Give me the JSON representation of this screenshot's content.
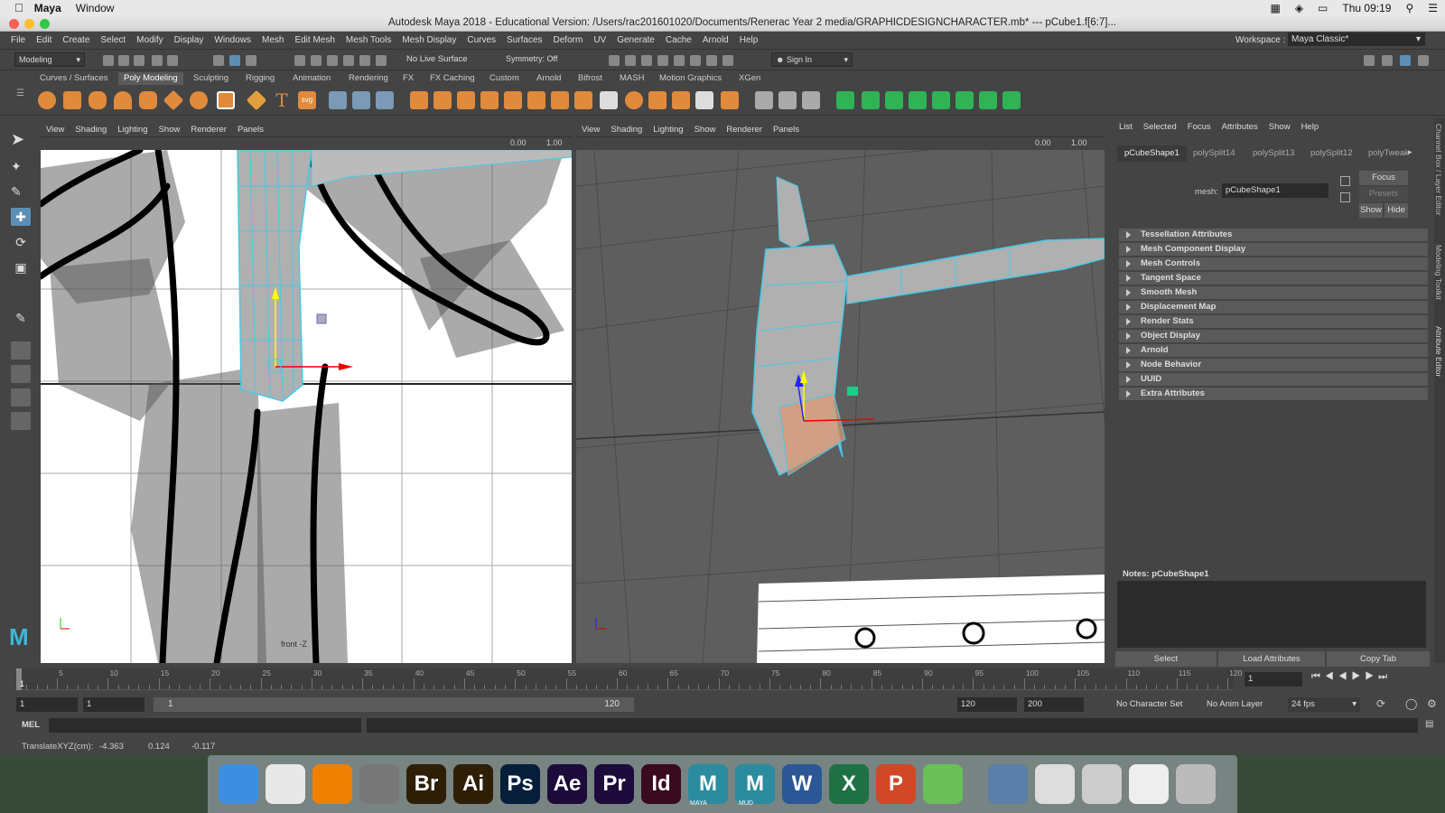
{
  "macmenu": {
    "app": "Maya",
    "items": [
      "Window"
    ],
    "clock": "Thu 09:19"
  },
  "title": "Autodesk Maya 2018 - Educational Version: /Users/rac201601020/Documents/Renerac Year 2 media/GRAPHICDESIGNCHARACTER.mb*   ---   pCube1.f[6:7]...",
  "menus": [
    "File",
    "Edit",
    "Create",
    "Select",
    "Modify",
    "Display",
    "Windows",
    "Mesh",
    "Edit Mesh",
    "Mesh Tools",
    "Mesh Display",
    "Curves",
    "Surfaces",
    "Deform",
    "UV",
    "Generate",
    "Cache",
    "Arnold",
    "Help"
  ],
  "workspace": {
    "label": "Workspace :",
    "value": "Maya Classic*"
  },
  "statusline": {
    "mode": "Modeling",
    "live_surface": "No Live Surface",
    "symmetry": "Symmetry: Off",
    "sign_in": "Sign In"
  },
  "shelf_tabs": [
    "Curves / Surfaces",
    "Poly Modeling",
    "Sculpting",
    "Rigging",
    "Animation",
    "Rendering",
    "FX",
    "FX Caching",
    "Custom",
    "Arnold",
    "Bifrost",
    "MASH",
    "Motion Graphics",
    "XGen"
  ],
  "shelf_active": "Poly Modeling",
  "viewport_menu": [
    "View",
    "Shading",
    "Lighting",
    "Show",
    "Renderer",
    "Panels"
  ],
  "viewport_values": {
    "v1": "0.00",
    "v2": "1.00"
  },
  "viewport1_label": "front -Z",
  "attr_menu": [
    "List",
    "Selected",
    "Focus",
    "Attributes",
    "Show",
    "Help"
  ],
  "attr_tabs": [
    "pCubeShape1",
    "polySplit14",
    "polySplit13",
    "polySplit12",
    "polyTweak"
  ],
  "mesh_label": "mesh:",
  "mesh_value": "pCubeShape1",
  "focus_btn": "Focus",
  "presets_btn": "Presets",
  "show_btn": "Show",
  "hide_btn": "Hide",
  "sections": [
    "Tessellation Attributes",
    "Mesh Component Display",
    "Mesh Controls",
    "Tangent Space",
    "Smooth Mesh",
    "Displacement Map",
    "Render Stats",
    "Object Display",
    "Arnold",
    "Node Behavior",
    "UUID",
    "Extra Attributes"
  ],
  "notes": "Notes:  pCubeShape1",
  "bottom_buttons": [
    "Select",
    "Load Attributes",
    "Copy Tab"
  ],
  "side_tabs": [
    "Channel Box / Layer Editor",
    "Modeling Toolkit",
    "Attribute Editor"
  ],
  "timeline": {
    "ticks": [
      "5",
      "10",
      "15",
      "20",
      "25",
      "30",
      "35",
      "40",
      "45",
      "50",
      "55",
      "60",
      "65",
      "70",
      "75",
      "80",
      "85",
      "90",
      "95",
      "100",
      "105",
      "110",
      "115",
      "120"
    ],
    "current_frame": "1",
    "current_field": "1"
  },
  "range": {
    "start": "1",
    "start2": "1",
    "slider_start": "1",
    "slider_end": "120",
    "end": "120",
    "end2": "200",
    "char_set": "No Character Set",
    "anim_layer": "No Anim Layer",
    "fps": "24 fps"
  },
  "cmd": {
    "label": "MEL"
  },
  "help": {
    "label": "TranslateXYZ(cm):",
    "x": "-4.363",
    "y": "0.124",
    "z": "-0.117"
  },
  "dock": [
    {
      "name": "finder-icon",
      "label": "",
      "color": "#3d8de0"
    },
    {
      "name": "chrome-icon",
      "label": "",
      "color": "#e8e8e8"
    },
    {
      "name": "vlc-icon",
      "label": "",
      "color": "#f08000"
    },
    {
      "name": "screenshot-icon",
      "label": "",
      "color": "#777"
    },
    {
      "name": "bridge-icon",
      "label": "Br",
      "color": "#2d1e05"
    },
    {
      "name": "illustrator-icon",
      "label": "Ai",
      "color": "#2d1e05"
    },
    {
      "name": "photoshop-icon",
      "label": "Ps",
      "color": "#061e3a"
    },
    {
      "name": "aftereffects-icon",
      "label": "Ae",
      "color": "#1c0b3b"
    },
    {
      "name": "premiere-icon",
      "label": "Pr",
      "color": "#1c0b3b"
    },
    {
      "name": "indesign-icon",
      "label": "Id",
      "color": "#3a0a1e"
    },
    {
      "name": "maya-icon",
      "label": "M",
      "color": "#2a8c9e"
    },
    {
      "name": "mudbox-icon",
      "label": "M",
      "color": "#2a8c9e"
    },
    {
      "name": "word-icon",
      "label": "W",
      "color": "#2b5797"
    },
    {
      "name": "excel-icon",
      "label": "X",
      "color": "#1e7145"
    },
    {
      "name": "powerpoint-icon",
      "label": "P",
      "color": "#d24726"
    },
    {
      "name": "maps-icon",
      "label": "",
      "color": "#6bbf59"
    },
    {
      "name": "apps-folder-icon",
      "label": "",
      "color": "#5a7fa8"
    },
    {
      "name": "calendar-doc-icon",
      "label": "",
      "color": "#ddd"
    },
    {
      "name": "chrome-doc-icon",
      "label": "",
      "color": "#ccc"
    },
    {
      "name": "document-icon",
      "label": "",
      "color": "#eee"
    },
    {
      "name": "trash-icon",
      "label": "",
      "color": "#bbb"
    }
  ],
  "dock_labels": {
    "maya": "MAYA",
    "mud": "MUD"
  }
}
